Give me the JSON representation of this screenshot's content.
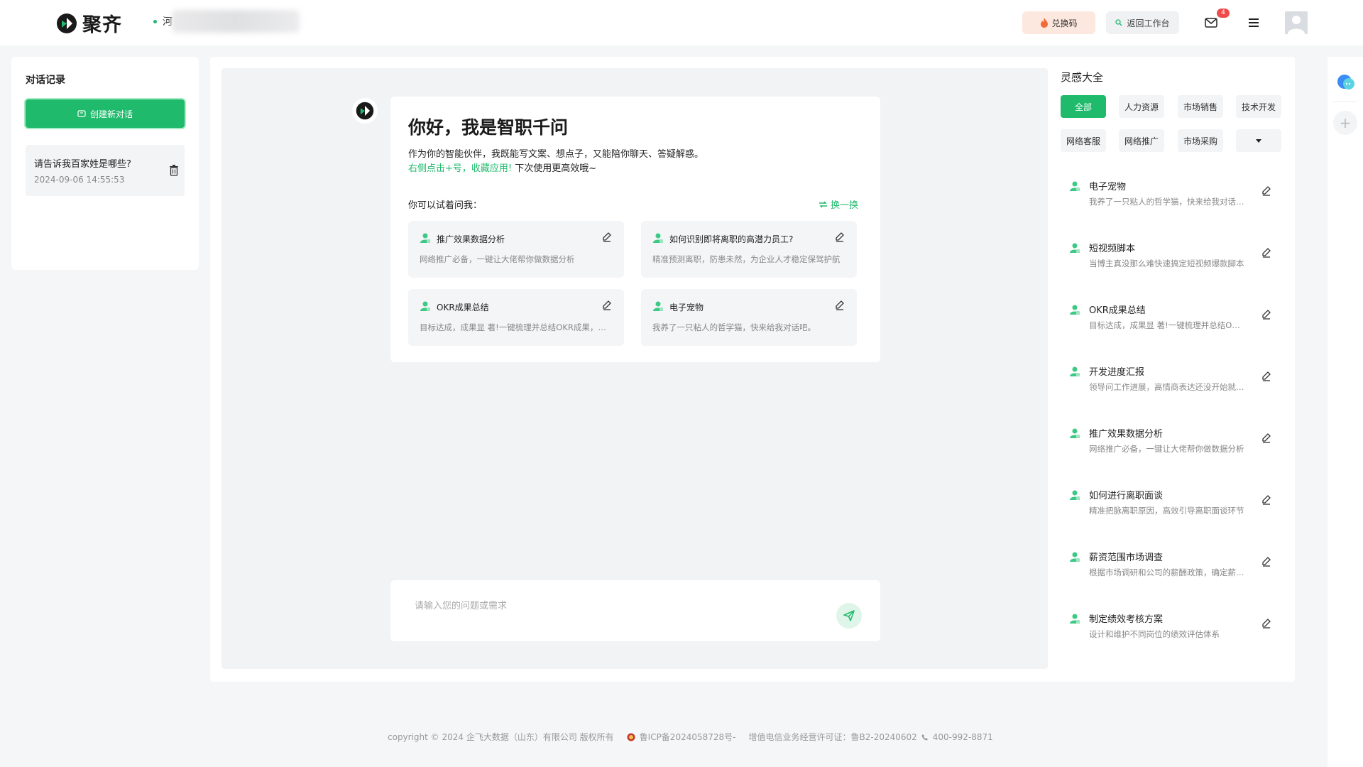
{
  "header": {
    "brand": "聚齐",
    "location_prefix": "河",
    "redeem_label": "兑换码",
    "back_label": "返回工作台",
    "mail_badge": "4",
    "colors": {
      "brand_green": "#1fba6b",
      "badge_red": "#f04b4b"
    }
  },
  "history": {
    "title": "对话记录",
    "new_chat_label": "创建新对话",
    "items": [
      {
        "title": "请告诉我百家姓是哪些?",
        "time": "2024-09-06 14:55:53"
      }
    ]
  },
  "welcome": {
    "title": "你好，我是智职千问",
    "desc": "作为你的智能伙伴，我既能写文案、想点子，又能陪你聊天、答疑解惑。",
    "hint_green": "右侧点击+号，收藏应用!",
    "hint_rest": " 下次使用更高效哦~",
    "ask_label": "你可以试着问我：",
    "swap_label": "换一换",
    "suggestions": [
      {
        "title": "推广效果数据分析",
        "desc": "网络推广必备，一键让大佬帮你做数据分析"
      },
      {
        "title": "如何识别即将离职的高潜力员工?",
        "desc": "精准预测离职，防患未然，为企业人才稳定保驾护航"
      },
      {
        "title": "OKR成果总结",
        "desc": "目标达成，成果显 著!一键梳理并总结OKR成果，助力团队成长"
      },
      {
        "title": "电子宠物",
        "desc": "我养了一只粘人的哲学猫，快来给我对话吧。"
      }
    ]
  },
  "input": {
    "placeholder": "请输入您的问题或需求"
  },
  "library": {
    "title": "灵感大全",
    "categories": [
      "全部",
      "人力资源",
      "市场销售",
      "技术开发",
      "网络客服",
      "网络推广",
      "市场采购"
    ],
    "more_icon": "caret-down-icon",
    "apps": [
      {
        "title": "电子宠物",
        "desc": "我养了一只粘人的哲学猫，快来给我对话吧。"
      },
      {
        "title": "短视频脚本",
        "desc": "当博主真没那么难快速搞定短视频爆款脚本"
      },
      {
        "title": "OKR成果总结",
        "desc": "目标达成，成果显 著!一键梳理并总结OKR成果"
      },
      {
        "title": "开发进度汇报",
        "desc": "领导问工作进展，高情商表达还没开始就被夸"
      },
      {
        "title": "推广效果数据分析",
        "desc": "网络推广必备，一键让大佬帮你做数据分析"
      },
      {
        "title": "如何进行离职面谈",
        "desc": "精准把脉离职原因，高效引导离职面谈环节"
      },
      {
        "title": "薪资范围市场调查",
        "desc": "根据市场调研和公司的薪酬政策，确定薪资范围"
      },
      {
        "title": "制定绩效考核方案",
        "desc": "设计和维护不同岗位的绩效评估体系"
      }
    ]
  },
  "footer": {
    "copyright": "copyright © 2024 企飞大数据（山东）有限公司 版权所有",
    "icp": "鲁ICP备2024058728号-",
    "license": "增值电信业务经营许可证：鲁B2-20240602",
    "phone": "400-992-8871"
  }
}
